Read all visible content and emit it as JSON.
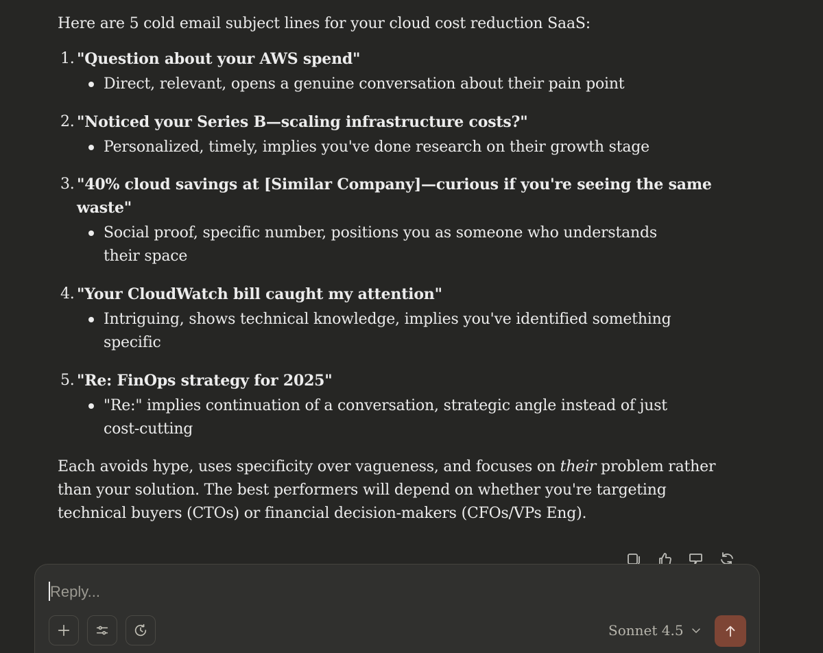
{
  "message": {
    "intro": "Here are 5 cold email subject lines for your cloud cost reduction SaaS:",
    "items": [
      {
        "number": "1.",
        "title": "\"Question about your AWS spend\"",
        "detail": "Direct, relevant, opens a genuine conversation about their pain point"
      },
      {
        "number": "2.",
        "title": "\"Noticed your Series B—scaling infrastructure costs?\"",
        "detail": "Personalized, timely, implies you've done research on their growth stage"
      },
      {
        "number": "3.",
        "title": "\"40% cloud savings at [Similar Company]—curious if you're seeing the same waste\"",
        "detail": "Social proof, specific number, positions you as someone who understands their space"
      },
      {
        "number": "4.",
        "title": "\"Your CloudWatch bill caught my attention\"",
        "detail": "Intriguing, shows technical knowledge, implies you've identified something specific"
      },
      {
        "number": "5.",
        "title": "\"Re: FinOps strategy for 2025\"",
        "detail": "\"Re:\" implies continuation of a conversation, strategic angle instead of just cost-cutting"
      }
    ],
    "outro": {
      "before": "Each avoids hype, uses specificity over vagueness, and focuses on ",
      "emphasis": "their",
      "after": " problem rather than your solution. The best performers will depend on whether you're targeting technical buyers (CTOs) or financial decision-makers (CFOs/VPs Eng)."
    }
  },
  "message_actions": [
    {
      "name": "copy-icon"
    },
    {
      "name": "thumbs-up-icon"
    },
    {
      "name": "thumbs-down-icon"
    },
    {
      "name": "retry-icon"
    }
  ],
  "composer": {
    "placeholder": "Reply...",
    "value": "",
    "tools": [
      {
        "name": "plus-icon"
      },
      {
        "name": "sliders-icon"
      },
      {
        "name": "clock-icon"
      }
    ],
    "model_label": "Sonnet 4.5",
    "send_icon": "arrow-up-icon",
    "send_color": "#7e4535"
  }
}
